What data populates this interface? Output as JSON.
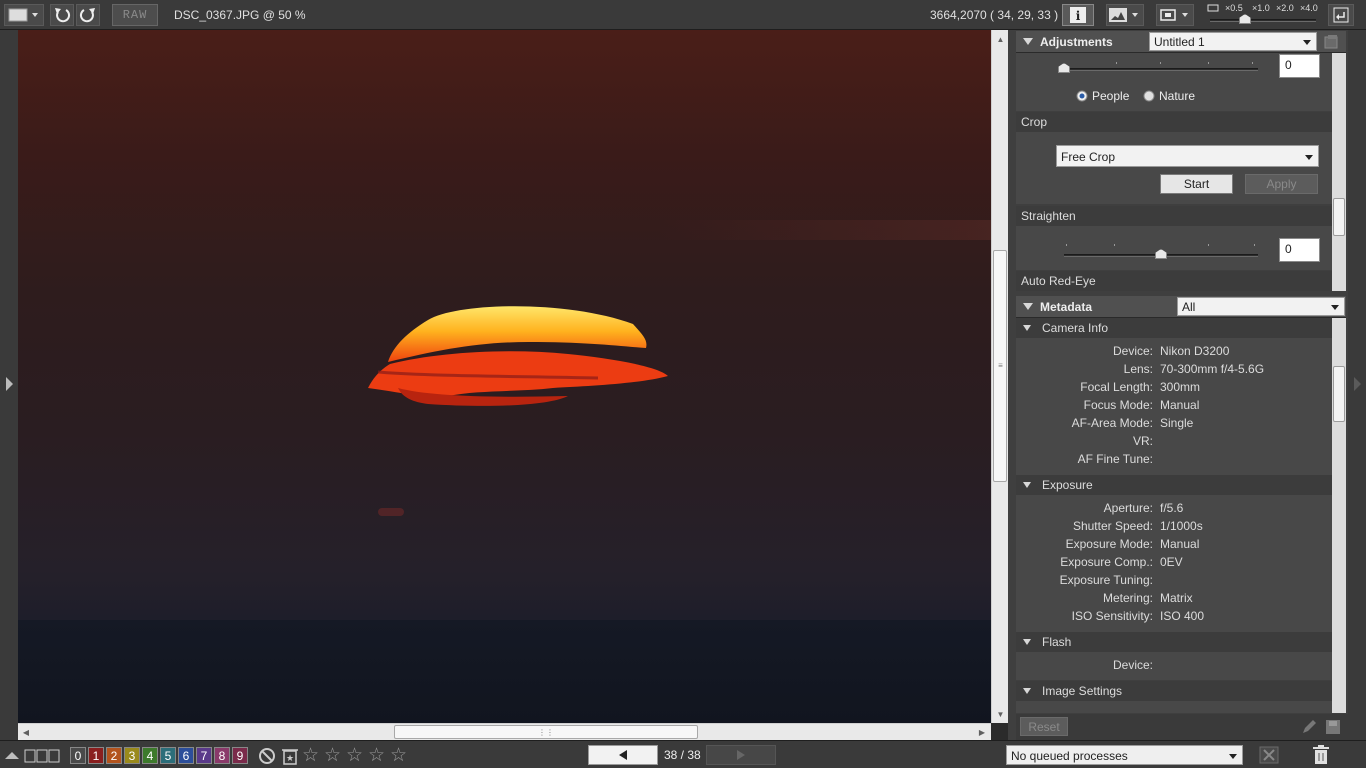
{
  "toolbar": {
    "raw_label": "RAW",
    "filename": "DSC_0367.JPG @ 50 %",
    "coords": "3664,2070 ( 34, 29, 33 )",
    "zoom_levels": [
      "×0.5",
      "×1.0",
      "×2.0",
      "×4.0"
    ],
    "zoom_slider_fraction": 0.33
  },
  "adjustments": {
    "title": "Adjustments",
    "preset": "Untitled 1",
    "slider_value": "0",
    "slider_fraction": 0.0,
    "radio_people": "People",
    "radio_nature": "Nature",
    "selected_radio": "People",
    "crop_label": "Crop",
    "crop_mode": "Free Crop",
    "start_label": "Start",
    "apply_label": "Apply",
    "straighten_label": "Straighten",
    "straighten_value": "0",
    "straighten_fraction": 0.5,
    "redeye_label": "Auto Red-Eye"
  },
  "metadata": {
    "title": "Metadata",
    "filter": "All",
    "sections": {
      "camera": "Camera Info",
      "exposure": "Exposure",
      "flash": "Flash",
      "image_settings": "Image Settings"
    },
    "camera_rows": [
      {
        "k": "Device:",
        "v": "Nikon D3200"
      },
      {
        "k": "Lens:",
        "v": "70-300mm f/4-5.6G"
      },
      {
        "k": "Focal Length:",
        "v": "300mm"
      },
      {
        "k": "Focus Mode:",
        "v": "Manual"
      },
      {
        "k": "AF-Area Mode:",
        "v": "Single"
      },
      {
        "k": "VR:",
        "v": ""
      },
      {
        "k": "AF Fine Tune:",
        "v": ""
      }
    ],
    "exposure_rows": [
      {
        "k": "Aperture:",
        "v": "f/5.6"
      },
      {
        "k": "Shutter Speed:",
        "v": "1/1000s"
      },
      {
        "k": "Exposure Mode:",
        "v": "Manual"
      },
      {
        "k": "Exposure Comp.:",
        "v": "0EV"
      },
      {
        "k": "Exposure Tuning:",
        "v": ""
      },
      {
        "k": "Metering:",
        "v": "Matrix"
      },
      {
        "k": "ISO Sensitivity:",
        "v": "ISO 400"
      }
    ],
    "flash_rows": [
      {
        "k": "Device:",
        "v": ""
      }
    ],
    "reset_label": "Reset"
  },
  "bottom": {
    "labels": [
      "0",
      "1",
      "2",
      "3",
      "4",
      "5",
      "6",
      "7",
      "8",
      "9"
    ],
    "label_colors": [
      "#4a4a4a",
      "#8a1f1f",
      "#b3541e",
      "#9a8a1c",
      "#3d7a2c",
      "#2c6e7a",
      "#2c4e9a",
      "#5a3a8a",
      "#8a3a6a",
      "#7a2a4a"
    ],
    "rating": 0,
    "pager": "38 / 38",
    "queue": "No queued processes"
  }
}
